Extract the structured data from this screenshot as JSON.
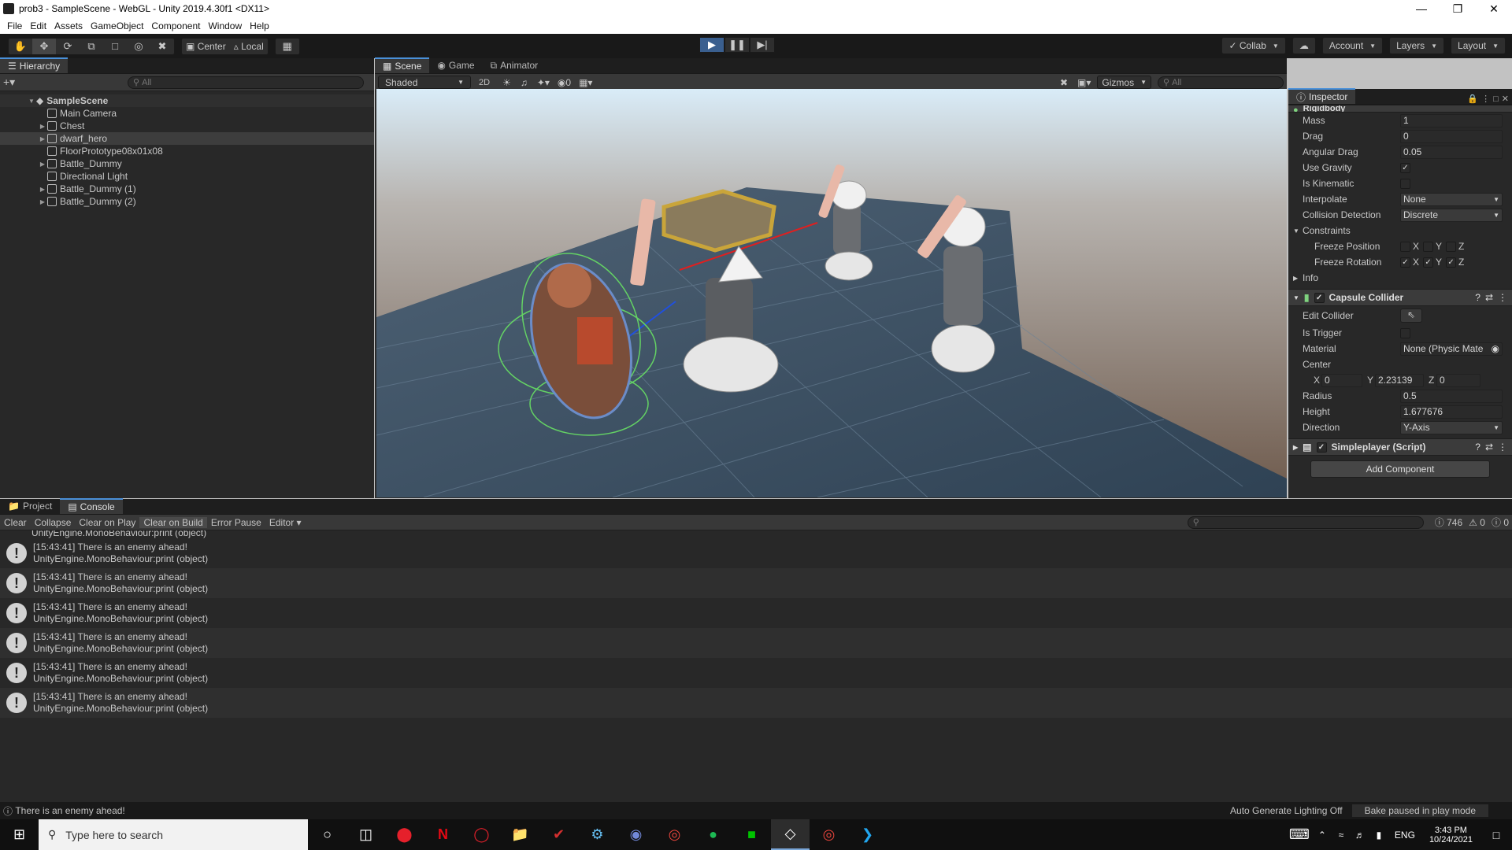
{
  "window": {
    "title": "prob3 - SampleScene - WebGL - Unity 2019.4.30f1 <DX11>"
  },
  "menu": [
    "File",
    "Edit",
    "Assets",
    "GameObject",
    "Component",
    "Window",
    "Help"
  ],
  "toolbar": {
    "center": "Center",
    "local": "Local",
    "collab": "Collab",
    "account": "Account",
    "layers": "Layers",
    "layout": "Layout"
  },
  "hierarchy": {
    "tab": "Hierarchy",
    "search_placeholder": "All",
    "scene": "SampleScene",
    "items": [
      {
        "label": "Main Camera",
        "expandable": false,
        "selected": false
      },
      {
        "label": "Chest",
        "expandable": true,
        "selected": false
      },
      {
        "label": "dwarf_hero",
        "expandable": true,
        "selected": true
      },
      {
        "label": "FloorPrototype08x01x08",
        "expandable": false,
        "selected": false
      },
      {
        "label": "Battle_Dummy",
        "expandable": true,
        "selected": false
      },
      {
        "label": "Directional Light",
        "expandable": false,
        "selected": false
      },
      {
        "label": "Battle_Dummy (1)",
        "expandable": true,
        "selected": false
      },
      {
        "label": "Battle_Dummy (2)",
        "expandable": true,
        "selected": false
      }
    ]
  },
  "scene": {
    "tabs": [
      "Scene",
      "Game",
      "Animator"
    ],
    "shading": "Shaded",
    "mode_2d": "2D",
    "hidden_count": "0",
    "gizmos": "Gizmos",
    "search_placeholder": "All"
  },
  "inspector": {
    "tab": "Inspector",
    "rigidbody": {
      "title": "Rigidbody",
      "mass_label": "Mass",
      "mass": "1",
      "drag_label": "Drag",
      "drag": "0",
      "angular_drag_label": "Angular Drag",
      "angular_drag": "0.05",
      "use_gravity_label": "Use Gravity",
      "is_kinematic_label": "Is Kinematic",
      "interpolate_label": "Interpolate",
      "interpolate": "None",
      "collision_label": "Collision Detection",
      "collision": "Discrete",
      "constraints_label": "Constraints",
      "freeze_pos_label": "Freeze Position",
      "freeze_rot_label": "Freeze Rotation",
      "info_label": "Info"
    },
    "capsule": {
      "title": "Capsule Collider",
      "edit_label": "Edit Collider",
      "trigger_label": "Is Trigger",
      "material_label": "Material",
      "material": "None (Physic Mate",
      "center_label": "Center",
      "cx": "0",
      "cy": "2.23139",
      "cz": "0",
      "radius_label": "Radius",
      "radius": "0.5",
      "height_label": "Height",
      "height": "1.677676",
      "direction_label": "Direction",
      "direction": "Y-Axis"
    },
    "script_title": "Simpleplayer (Script)",
    "add_component": "Add Component"
  },
  "console": {
    "tabs": [
      "Project",
      "Console"
    ],
    "buttons": [
      "Clear",
      "Collapse",
      "Clear on Play",
      "Clear on Build",
      "Error Pause",
      "Editor"
    ],
    "counts": {
      "log": "746",
      "warn": "0",
      "error": "0"
    },
    "cut_line": "UnityEngine.MonoBehaviour:print (object)",
    "entries": [
      {
        "msg": "[15:43:41] There is an enemy ahead!",
        "src": "UnityEngine.MonoBehaviour:print (object)"
      },
      {
        "msg": "[15:43:41] There is an enemy ahead!",
        "src": "UnityEngine.MonoBehaviour:print (object)"
      },
      {
        "msg": "[15:43:41] There is an enemy ahead!",
        "src": "UnityEngine.MonoBehaviour:print (object)"
      },
      {
        "msg": "[15:43:41] There is an enemy ahead!",
        "src": "UnityEngine.MonoBehaviour:print (object)"
      },
      {
        "msg": "[15:43:41] There is an enemy ahead!",
        "src": "UnityEngine.MonoBehaviour:print (object)"
      },
      {
        "msg": "[15:43:41] There is an enemy ahead!",
        "src": "UnityEngine.MonoBehaviour:print (object)"
      }
    ]
  },
  "status": {
    "message": "There is an enemy ahead!",
    "lighting": "Auto Generate Lighting Off",
    "bake": "Bake paused in play mode"
  },
  "taskbar": {
    "search_placeholder": "Type here to search",
    "lang": "ENG",
    "time": "3:43 PM",
    "date": "10/24/2021"
  }
}
